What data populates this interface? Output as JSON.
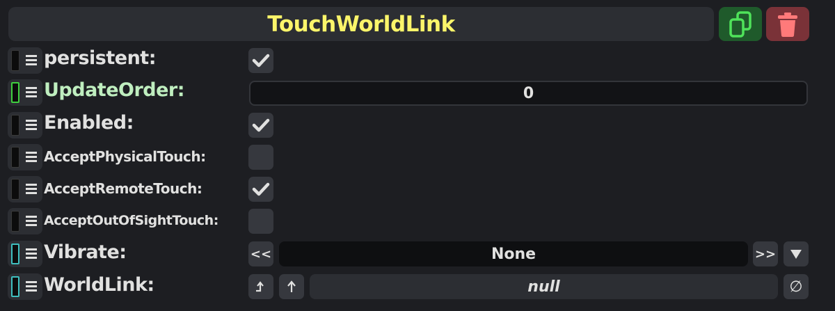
{
  "component": {
    "title": "TouchWorldLink",
    "duplicate_icon": "duplicate-icon",
    "delete_icon": "trash-icon"
  },
  "fields": {
    "persistent": {
      "label": "persistent:",
      "checked": true
    },
    "update_order": {
      "label": "UpdateOrder:",
      "value": "0"
    },
    "enabled": {
      "label": "Enabled:",
      "checked": true
    },
    "accept_physical_touch": {
      "label": "AcceptPhysicalTouch:",
      "checked": false
    },
    "accept_remote_touch": {
      "label": "AcceptRemoteTouch:",
      "checked": true
    },
    "accept_out_of_sight_touch": {
      "label": "AcceptOutOfSightTouch:",
      "checked": false
    },
    "vibrate": {
      "label": "Vibrate:",
      "value": "None",
      "prev": "<<",
      "next": ">>"
    },
    "world_link": {
      "label": "WorldLink:",
      "value": "null",
      "clear": "∅"
    }
  },
  "colors": {
    "title": "#fbf56a",
    "duplicate_bg": "#1f5a2b",
    "duplicate_fg": "#4fe35a",
    "delete_bg": "#7a3238",
    "delete_fg": "#ff7a7a",
    "update_order_label": "#bfeebf"
  }
}
